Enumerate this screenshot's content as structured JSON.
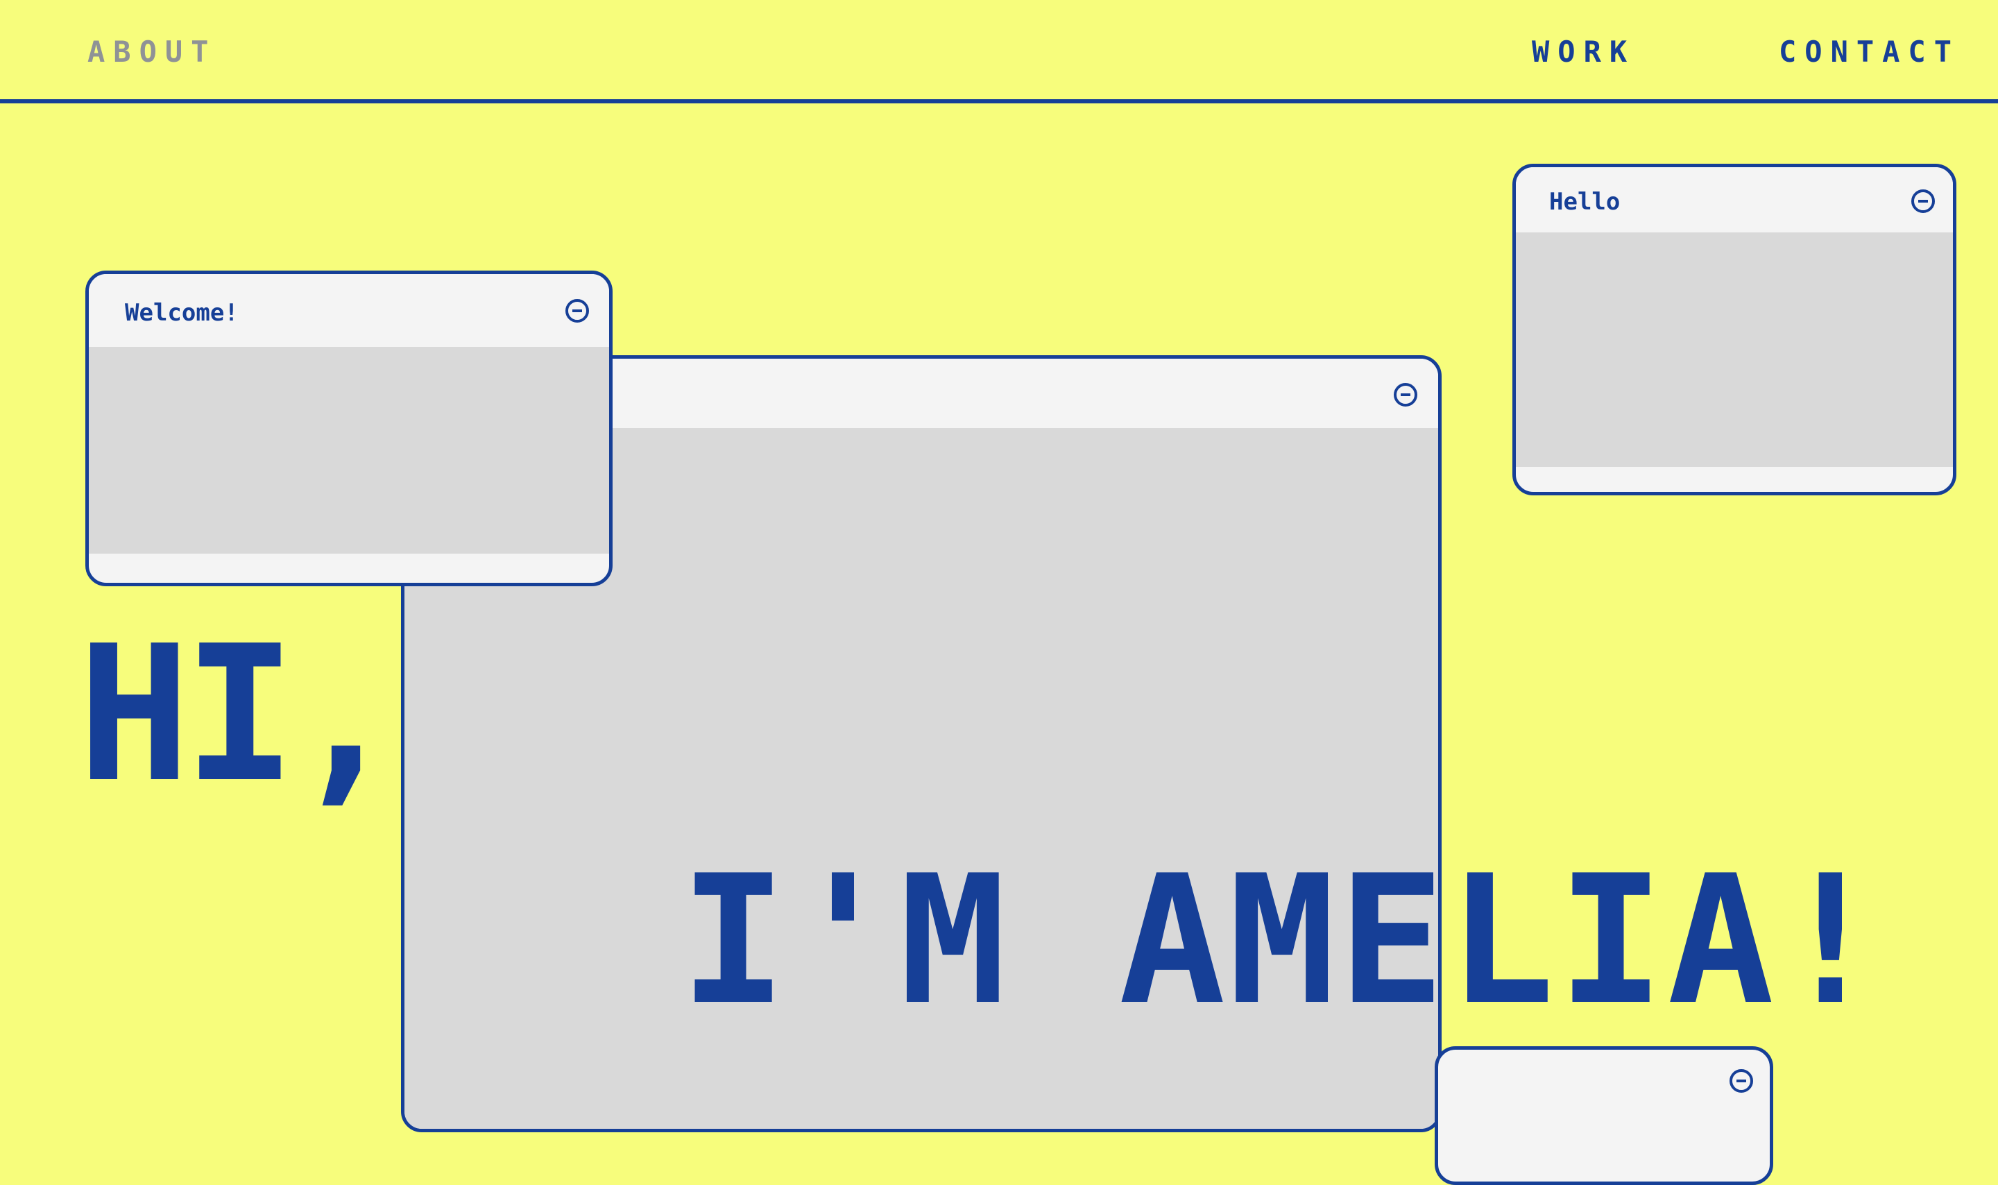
{
  "nav": {
    "about_label": "ABOUT",
    "work_label": "WORK",
    "contact_label": "CONTACT"
  },
  "windows": {
    "welcome": {
      "title": "Welcome!"
    },
    "hello": {
      "title": "Hello"
    },
    "main": {
      "title": ""
    },
    "bottom": {
      "title": ""
    }
  },
  "hero": {
    "greeting": "HI,",
    "name_line": "I'M AMELIA!"
  },
  "colors": {
    "background": "#f7fd7c",
    "primary": "#163f97",
    "muted_nav": "#8f9296",
    "window_bar": "#f4f4f4",
    "window_content": "#d9d9d9"
  },
  "icons": {
    "window_control": "minimize-circle-icon"
  }
}
